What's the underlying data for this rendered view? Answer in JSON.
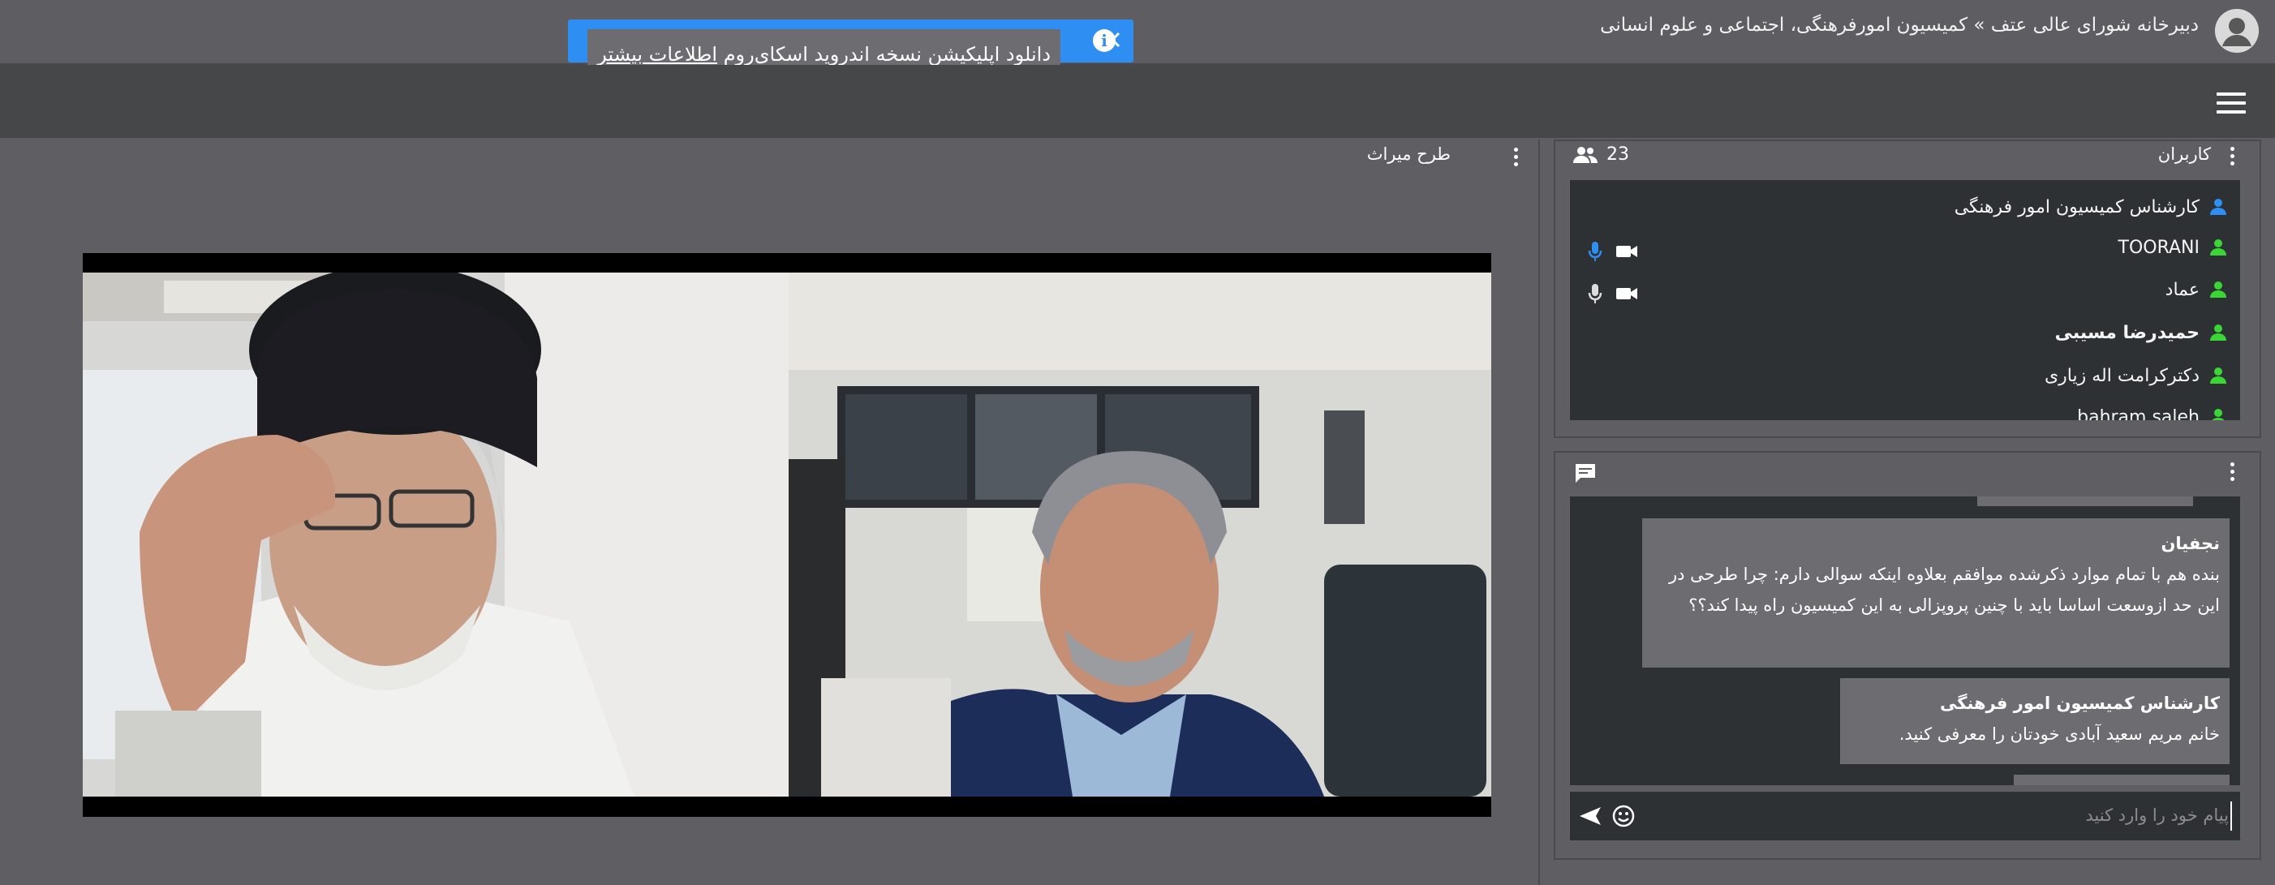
{
  "header": {
    "breadcrumb": "دبیرخانه شورای عالی عتف » کمیسیون امورفرهنگی، اجتماعی و علوم انسانی"
  },
  "notice": {
    "message": "دانلود اپلیکیشن نسخه اندروید اسکای‌روم",
    "link": "اطلاعات بیشتر"
  },
  "stage": {
    "title": "طرح میراث"
  },
  "users_panel": {
    "title": "کاربران",
    "count": "23",
    "users": [
      {
        "name": "کارشناس کمیسیون امور فرهنگی",
        "role": "host",
        "mic": false,
        "cam": false,
        "bold": false
      },
      {
        "name": "TOORANI",
        "role": "participant",
        "mic": true,
        "cam": true,
        "bold": false,
        "mic_color": "#2f8ef2"
      },
      {
        "name": "عماد",
        "role": "participant",
        "mic": true,
        "cam": true,
        "bold": false,
        "mic_color": "#dddddd"
      },
      {
        "name": "حمیدرضا مسیبی",
        "role": "participant",
        "mic": false,
        "cam": false,
        "bold": true
      },
      {
        "name": "دکترکرامت اله زیاری",
        "role": "participant",
        "mic": false,
        "cam": false,
        "bold": false
      },
      {
        "name": "bahram saleh",
        "role": "participant",
        "mic": false,
        "cam": false,
        "bold": false
      }
    ]
  },
  "chat": {
    "messages": [
      {
        "sender": "نجفیان",
        "text": "بنده هم با تمام موارد ذکرشده موافقم بعلاوه اینکه سوالی دارم: چرا طرحی در این حد ازوسعت اساسا باید با چنین پروپزالی به این کمیسیون راه پیدا کند؟؟"
      },
      {
        "sender": "کارشناس کمیسیون امور فرهنگی",
        "text": "خانم مریم سعید آبادی خودتان را معرفی کنید."
      }
    ],
    "input_placeholder": "پیام خود را وارد کنید"
  },
  "icons": {
    "menu": "hamburger-icon",
    "users": "people-icon",
    "chat": "chat-icon",
    "send": "send-icon",
    "emoji": "emoji-icon",
    "close": "close-icon",
    "info": "info-icon"
  },
  "colors": {
    "host_icon": "#2f8ef2",
    "participant_icon": "#39d636",
    "notice_bg": "#2f8ef2"
  }
}
